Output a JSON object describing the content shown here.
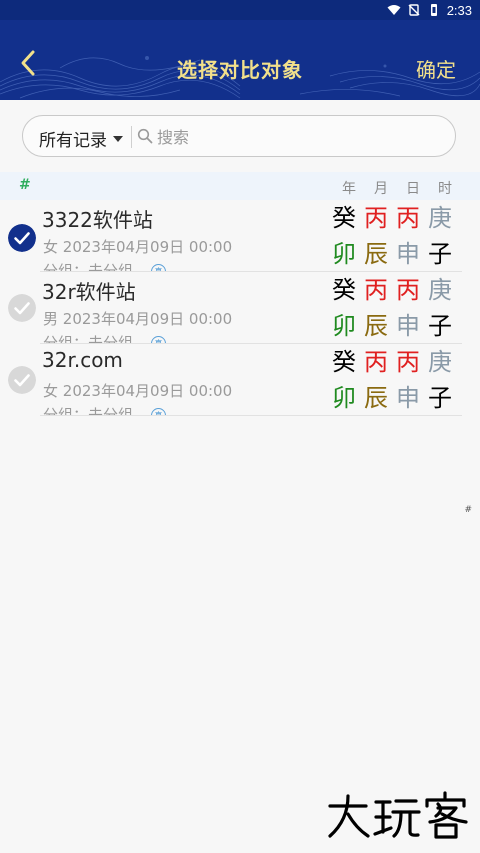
{
  "status_bar": {
    "time": "2:33",
    "icons": [
      "wifi-icon",
      "no-sim-icon",
      "battery-icon"
    ]
  },
  "header": {
    "back_icon": "chevron-left-icon",
    "title": "选择对比对象",
    "confirm_label": "确定"
  },
  "search": {
    "filter_label": "所有记录",
    "placeholder": "搜索"
  },
  "list_header": {
    "index_symbol": "#",
    "columns": [
      "年",
      "月",
      "日",
      "时"
    ]
  },
  "records": [
    {
      "name": "3322软件站",
      "gender": "女",
      "date": "2023年04月09日 00:00",
      "group": "分组：未分组",
      "badge": "真",
      "selected": true,
      "pillars_top": [
        "癸",
        "丙",
        "丙",
        "庚"
      ],
      "pillars_bottom": [
        "卯",
        "辰",
        "申",
        "子"
      ]
    },
    {
      "name": "32r软件站",
      "gender": "男",
      "date": "2023年04月09日 00:00",
      "group": "分组：未分组",
      "badge": "真",
      "selected": false,
      "pillars_top": [
        "癸",
        "丙",
        "丙",
        "庚"
      ],
      "pillars_bottom": [
        "卯",
        "辰",
        "申",
        "子"
      ]
    },
    {
      "name": "32r.com",
      "gender": "女",
      "date": "2023年04月09日 00:00",
      "group": "分组：未分组",
      "badge": "真",
      "selected": false,
      "pillars_top": [
        "癸",
        "丙",
        "丙",
        "庚"
      ],
      "pillars_bottom": [
        "卯",
        "辰",
        "申",
        "子"
      ]
    }
  ],
  "colors": {
    "header_bg": "#12308c",
    "header_text": "#f2e08b",
    "water": "#000000",
    "fire": "#e02020",
    "metal": "#8a9aa8",
    "wood": "#1f8a1f",
    "earth": "#8a6a10",
    "checked": "#12308c",
    "unchecked": "#d8d8d8"
  },
  "pillar_colors_top": [
    "water",
    "fire",
    "fire",
    "metal"
  ],
  "pillar_colors_bottom": [
    "wood",
    "earth",
    "metal",
    "water"
  ],
  "side_index": "#",
  "watermark": "大玩客"
}
